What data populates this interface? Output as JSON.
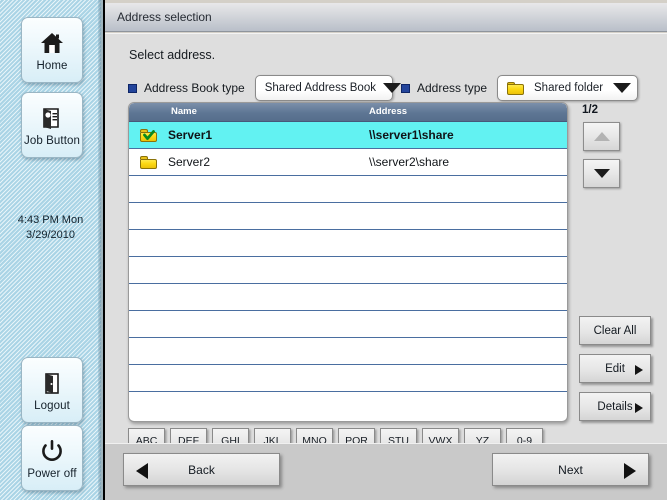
{
  "sidebar": {
    "buttons": [
      {
        "label": "Home",
        "icon": "home-icon"
      },
      {
        "label": "Job Button",
        "icon": "job-list-icon"
      },
      {
        "label": "Logout",
        "icon": "door-exit-icon"
      },
      {
        "label": "Power off",
        "icon": "power-icon"
      }
    ],
    "clock": {
      "time": "4:43 PM  Mon",
      "date": "3/29/2010"
    }
  },
  "window": {
    "title": "Address selection",
    "instruction": "Select address."
  },
  "options": {
    "book_type": {
      "label": "Address Book type",
      "value": "Shared Address Book",
      "icon": "chevron-down-icon"
    },
    "address_type": {
      "label": "Address type",
      "value": "Shared folder",
      "icon": "folder-icon"
    }
  },
  "list": {
    "columns": {
      "name": "Name",
      "address": "Address"
    },
    "rows": [
      {
        "name": "Server1",
        "address": "\\\\server1\\share",
        "selected": true,
        "icon": "folder-checked-icon"
      },
      {
        "name": "Server2",
        "address": "\\\\server2\\share",
        "selected": false,
        "icon": "folder-icon"
      },
      {
        "name": "",
        "address": "",
        "selected": false,
        "icon": ""
      },
      {
        "name": "",
        "address": "",
        "selected": false,
        "icon": ""
      },
      {
        "name": "",
        "address": "",
        "selected": false,
        "icon": ""
      },
      {
        "name": "",
        "address": "",
        "selected": false,
        "icon": ""
      },
      {
        "name": "",
        "address": "",
        "selected": false,
        "icon": ""
      },
      {
        "name": "",
        "address": "",
        "selected": false,
        "icon": ""
      },
      {
        "name": "",
        "address": "",
        "selected": false,
        "icon": ""
      },
      {
        "name": "",
        "address": "",
        "selected": false,
        "icon": ""
      }
    ]
  },
  "pagination": {
    "indicator": "1/2",
    "scroll_up": "scroll-up-icon",
    "scroll_down": "scroll-down-icon"
  },
  "actions": [
    {
      "label": "Clear All",
      "has_submenu": false
    },
    {
      "label": "Edit",
      "has_submenu": true
    },
    {
      "label": "Details",
      "has_submenu": true
    }
  ],
  "alphabet_filters": [
    "ABC",
    "DEF",
    "GHI",
    "JKL",
    "MNO",
    "PQR",
    "STU",
    "VWX",
    "YZ",
    "0-9"
  ],
  "footer": {
    "back": "Back",
    "next": "Next"
  },
  "colors": {
    "selection": "#62f2f2",
    "header_blue": "#5e7694",
    "marker_blue": "#23449b",
    "folder_yellow": "#fcd913",
    "sidebar_blue": "#bfe2f0"
  }
}
